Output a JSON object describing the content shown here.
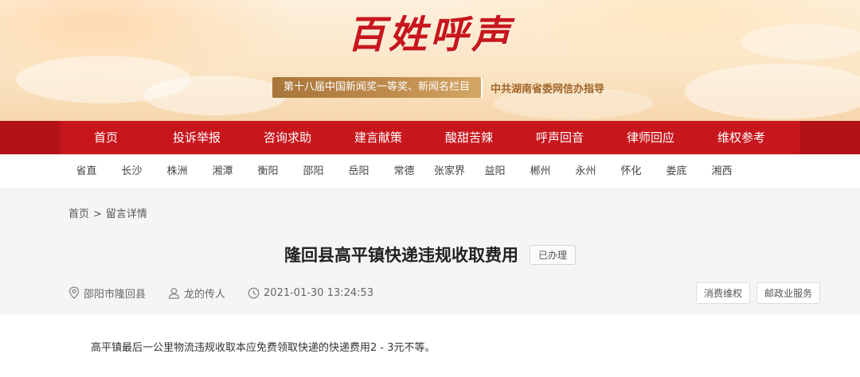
{
  "banner": {
    "logo_text": "百姓呼声",
    "award_text": "第十八届中国新闻奖一等奖、新闻名栏目",
    "guide_text": "中共湖南省委网信办指导"
  },
  "main_nav": {
    "items": [
      "首页",
      "投诉举报",
      "咨询求助",
      "建言献策",
      "酸甜苦辣",
      "呼声回音",
      "律师回应",
      "维权参考"
    ]
  },
  "region_nav": {
    "items": [
      "省直",
      "长沙",
      "株洲",
      "湘潭",
      "衡阳",
      "邵阳",
      "岳阳",
      "常德",
      "张家界",
      "益阳",
      "郴州",
      "永州",
      "怀化",
      "娄底",
      "湘西"
    ]
  },
  "breadcrumb": {
    "home": "首页",
    "separator": ">",
    "current": "留言详情"
  },
  "post": {
    "title": "隆回县高平镇快递违规收取费用",
    "status": "已办理",
    "location": "邵阳市隆回县",
    "author": "龙的传人",
    "datetime": "2021-01-30 13:24:53",
    "tags": [
      "消费维权",
      "邮政业服务"
    ],
    "body": "高平镇最后一公里物流违规收取本应免费领取快递的快递费用2 - 3元不等。"
  },
  "colors": {
    "nav_red": "#c8161d",
    "award_gold": "#c08d4e"
  }
}
